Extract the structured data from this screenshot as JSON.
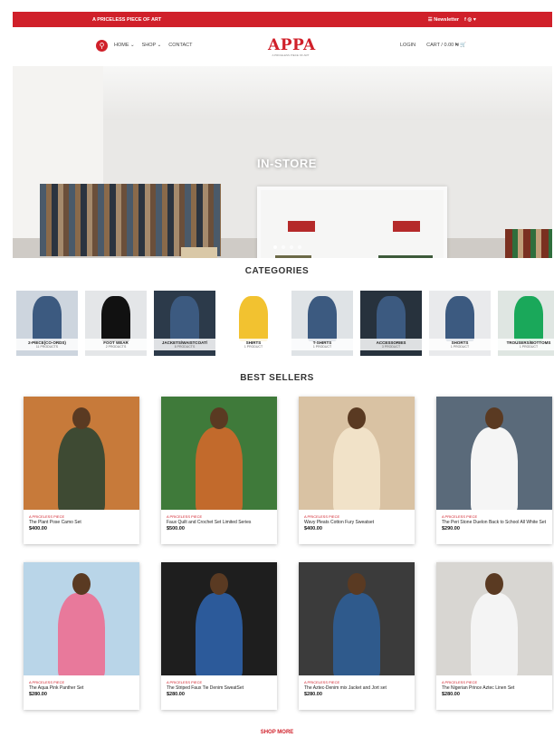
{
  "topbar": {
    "left": "A PRICELESS PIECE OF ART",
    "newsletter": "☰ Newsletter",
    "social": "f ◎ ♥"
  },
  "nav": {
    "home": "HOME ⌄",
    "shop": "SHOP ⌄",
    "contact": "CONTACT"
  },
  "logo": {
    "word": "APPA",
    "tagline": "A PRICELESS PIECE OF ART"
  },
  "header_right": {
    "login": "LOGIN",
    "cart": "CART / 0.00 ₦"
  },
  "hero": {
    "title": "IN-STORE",
    "slides": 4,
    "active_slide": 1
  },
  "categories": {
    "title": "CATEGORIES",
    "items": [
      {
        "name": "2-PIECE(CO-ORDS)",
        "count": "11 PRODUCTS"
      },
      {
        "name": "FOOT WEAR",
        "count": "2 PRODUCTS"
      },
      {
        "name": "JACKETS/WAISTCOAT/",
        "count": "8 PRODUCTS"
      },
      {
        "name": "SHIRTS",
        "count": "1 PRODUCT"
      },
      {
        "name": "T-SHIRTS",
        "count": "1 PRODUCT"
      },
      {
        "name": "ACCESSORIES",
        "count": "3 PRODUCT"
      },
      {
        "name": "SHORTS",
        "count": "1 PRODUCT"
      },
      {
        "name": "TROUSERS/BOTTOMS",
        "count": "1 PRODUCT"
      }
    ]
  },
  "best_sellers": {
    "title": "BEST SELLERS",
    "products": [
      {
        "brand": "A PRICELESS PIECE",
        "name": "The Plant Pose Camo Set",
        "price": "$400.00"
      },
      {
        "brand": "A PRICELESS PIECE",
        "name": "Faux Quilt and Crochet Set Limited Series",
        "price": "$500.00"
      },
      {
        "brand": "A PRICELESS PIECE",
        "name": "Wavy Pleats Cotton Fury Sweatset",
        "price": "$400.00"
      },
      {
        "brand": "A PRICELESS PIECE",
        "name": "The Peri Stone Duelon Back to School All White Set",
        "price": "$290.00"
      },
      {
        "brand": "A PRICELESS PIECE",
        "name": "The Aqua Pink Panther Set",
        "price": "$280.00"
      },
      {
        "brand": "A PRICELESS PIECE",
        "name": "The Striped Faux Tie Denim SweatSet",
        "price": "$280.00"
      },
      {
        "brand": "A PRICELESS PIECE",
        "name": "The Aztec-Denim mix Jacket and Jort set",
        "price": "$280.00"
      },
      {
        "brand": "A PRICELESS PIECE",
        "name": "The Nigerian Prince Aztec Linen Set",
        "price": "$280.00"
      }
    ]
  },
  "shop_more": "SHOP MORE",
  "colors": {
    "accent": "#d0202a"
  }
}
